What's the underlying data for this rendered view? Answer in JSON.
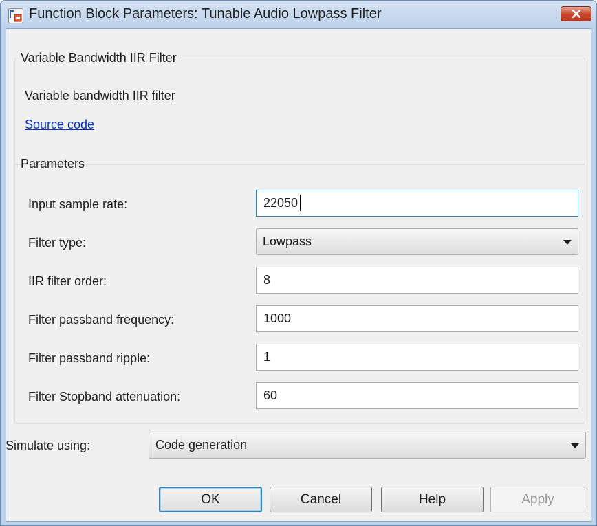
{
  "window": {
    "title": "Function Block Parameters: Tunable Audio Lowpass Filter",
    "icon": "simulink-block-icon",
    "close_icon": "close-icon",
    "close_color": "#c8452a"
  },
  "description": {
    "group_title": "Variable Bandwidth IIR Filter",
    "text": "Variable bandwidth IIR filter",
    "link": "Source code"
  },
  "parameters": {
    "group_title": "Parameters",
    "input_sample_rate": {
      "label": "Input sample rate:",
      "value": "22050"
    },
    "filter_type": {
      "label": "Filter type:",
      "value": "Lowpass"
    },
    "iir_filter_order": {
      "label": "IIR filter order:",
      "value": "8"
    },
    "passband_frequency": {
      "label": "Filter passband frequency:",
      "value": "1000"
    },
    "passband_ripple": {
      "label": "Filter passband ripple:",
      "value": "1"
    },
    "stopband_attenuation": {
      "label": "Filter Stopband attenuation:",
      "value": "60"
    }
  },
  "simulate": {
    "label": "Simulate using:",
    "value": "Code generation"
  },
  "buttons": {
    "ok": "OK",
    "cancel": "Cancel",
    "help": "Help",
    "apply": "Apply"
  },
  "colors": {
    "link": "#0033cc",
    "focus_border": "#3c7fb1",
    "window_frame": "#bcd1ea"
  }
}
